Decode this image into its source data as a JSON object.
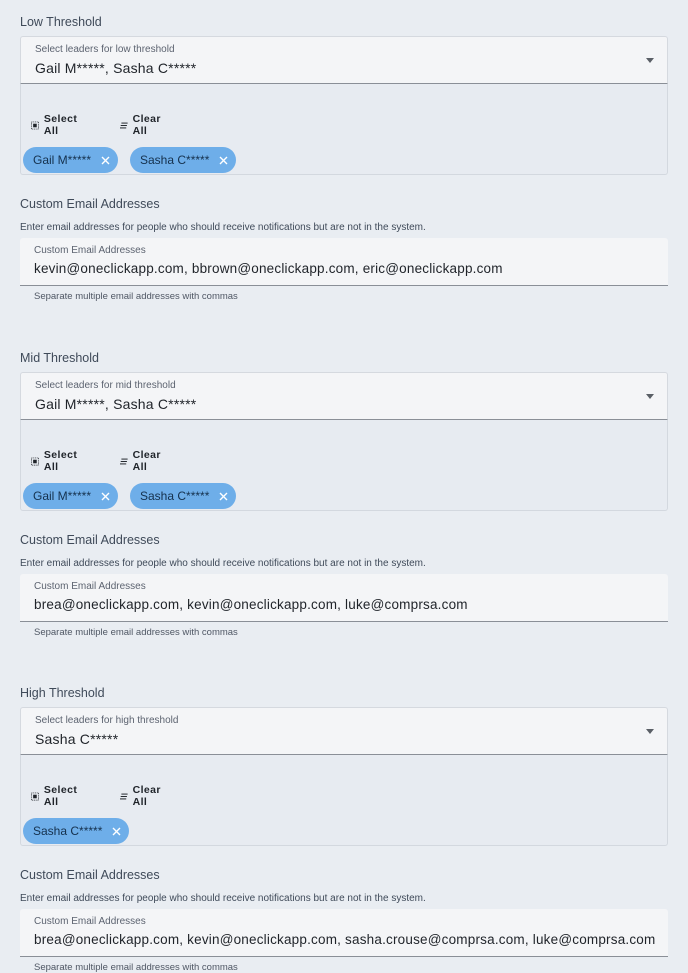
{
  "sections": [
    {
      "title": "Low Threshold",
      "select_label": "Select leaders for low threshold",
      "select_value": "Gail M*****, Sasha C*****",
      "select_all": "Select All",
      "clear_all": "Clear All",
      "chips": [
        "Gail M*****",
        "Sasha C*****"
      ],
      "custom_title": "Custom Email Addresses",
      "custom_desc": "Enter email addresses for people who should receive notifications but are not in the system.",
      "custom_label": "Custom Email Addresses",
      "custom_value": "kevin@oneclickapp.com, bbrown@oneclickapp.com, eric@oneclickapp.com",
      "custom_help": "Separate multiple email addresses with commas"
    },
    {
      "title": "Mid Threshold",
      "select_label": "Select leaders for mid threshold",
      "select_value": "Gail M*****, Sasha C*****",
      "select_all": "Select All",
      "clear_all": "Clear All",
      "chips": [
        "Gail M*****",
        "Sasha C*****"
      ],
      "custom_title": "Custom Email Addresses",
      "custom_desc": "Enter email addresses for people who should receive notifications but are not in the system.",
      "custom_label": "Custom Email Addresses",
      "custom_value": "brea@oneclickapp.com, kevin@oneclickapp.com, luke@comprsa.com",
      "custom_help": "Separate multiple email addresses with commas"
    },
    {
      "title": "High Threshold",
      "select_label": "Select leaders for high threshold",
      "select_value": "Sasha C*****",
      "select_all": "Select All",
      "clear_all": "Clear All",
      "chips": [
        "Sasha C*****"
      ],
      "custom_title": "Custom Email Addresses",
      "custom_desc": "Enter email addresses for people who should receive notifications but are not in the system.",
      "custom_label": "Custom Email Addresses",
      "custom_value": "brea@oneclickapp.com, kevin@oneclickapp.com, sasha.crouse@comprsa.com, luke@comprsa.com",
      "custom_help": "Separate multiple email addresses with commas"
    }
  ],
  "icons": {
    "dropdown": "caret-down-icon",
    "select_all": "select-all-icon",
    "clear_all": "clear-all-icon",
    "chip_remove": "close-icon"
  },
  "colors": {
    "chip_bg": "#6eaee9",
    "page_bg": "#e9edf2"
  }
}
